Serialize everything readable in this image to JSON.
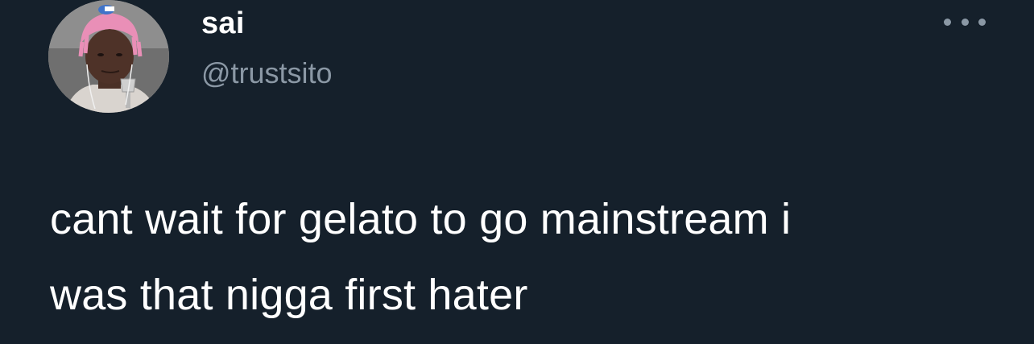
{
  "user": {
    "display_name": "sai",
    "handle": "@trustsito"
  },
  "tweet": {
    "text_line_1": "cant wait for gelato to go mainstream i",
    "text_line_2": "was that nigga first hater"
  },
  "icons": {
    "more": "more-horizontal-icon",
    "avatar": "avatar-image"
  },
  "colors": {
    "background": "#15202b",
    "primary_text": "#ffffff",
    "secondary_text": "#8b98a5"
  }
}
